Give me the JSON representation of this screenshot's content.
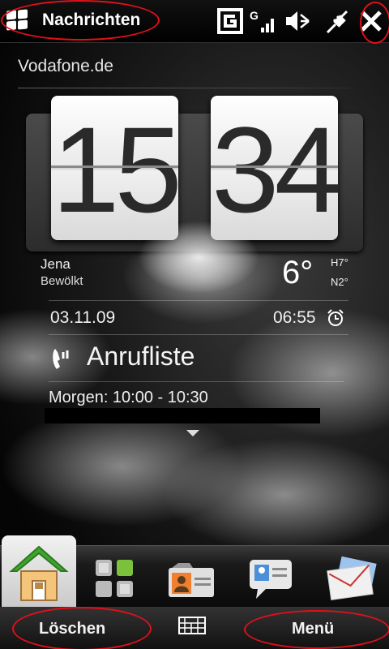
{
  "status_bar": {
    "app_title": "Nachrichten",
    "icons": [
      "windows-start-icon",
      "gprs-icon",
      "signal-icon",
      "volume-muted-icon",
      "connection-icon",
      "close-icon"
    ]
  },
  "home": {
    "carrier": "Vodafone.de",
    "clock": {
      "hours": "15",
      "minutes": "34"
    },
    "weather": {
      "city": "Jena",
      "condition": "Bewölkt",
      "temp": "6°",
      "high": "H7°",
      "low": "N2°"
    },
    "date": "03.11.09",
    "alarm": "06:55",
    "calllog_label": "Anrufliste",
    "appointment": "Morgen: 10:00 - 10:30"
  },
  "tabs": [
    "home-tab",
    "apps-tab",
    "contacts-tab",
    "messages-tab",
    "mail-tab"
  ],
  "softkeys": {
    "left": "Löschen",
    "right": "Menü"
  },
  "colors": {
    "highlight_ring": "#e0101a",
    "home_roof": "#3fa42f",
    "apps_accent": "#7bc13b"
  }
}
